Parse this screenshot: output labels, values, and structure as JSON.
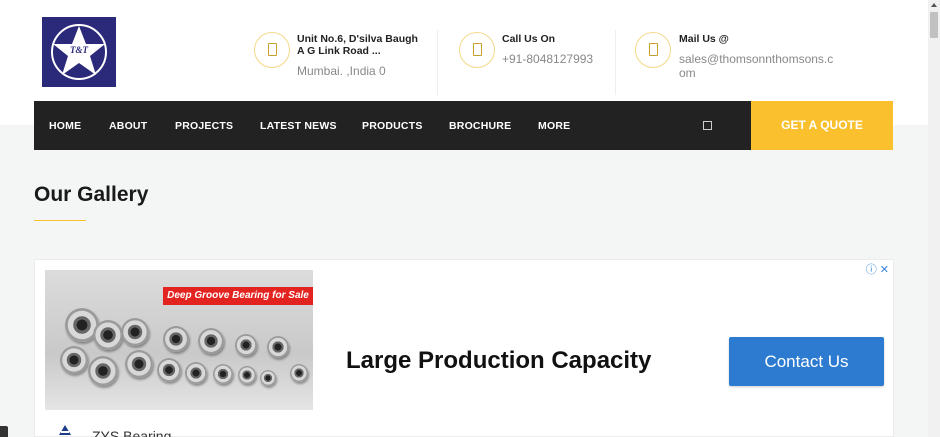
{
  "header": {
    "address_title": "Unit No.6, D'silva Baugh A G Link Road ...",
    "address_value": "Mumbai. ,India 0",
    "call_title": "Call Us On",
    "call_value": "+91-8048127993",
    "mail_title": "Mail Us @",
    "mail_value": "sales@thomsonnthomsons.com",
    "logo_text": "T&T"
  },
  "nav": {
    "items": [
      "HOME",
      "ABOUT",
      "PROJECTS",
      "LATEST NEWS",
      "PRODUCTS",
      "BROCHURE",
      "MORE"
    ],
    "quote_label": "GET A QUOTE"
  },
  "gallery": {
    "title": "Our Gallery"
  },
  "ad": {
    "banner_text": "Deep Groove Bearing for Sale",
    "headline": "Large Production Capacity",
    "cta_label": "Contact Us",
    "brand": "ZYS Bearing",
    "choices_label": "ⓘ ✕"
  },
  "colors": {
    "accent": "#fbc02d",
    "nav_bg": "#222222",
    "cta_blue": "#2d7bd1",
    "logo_bg": "#2b2a7a"
  }
}
